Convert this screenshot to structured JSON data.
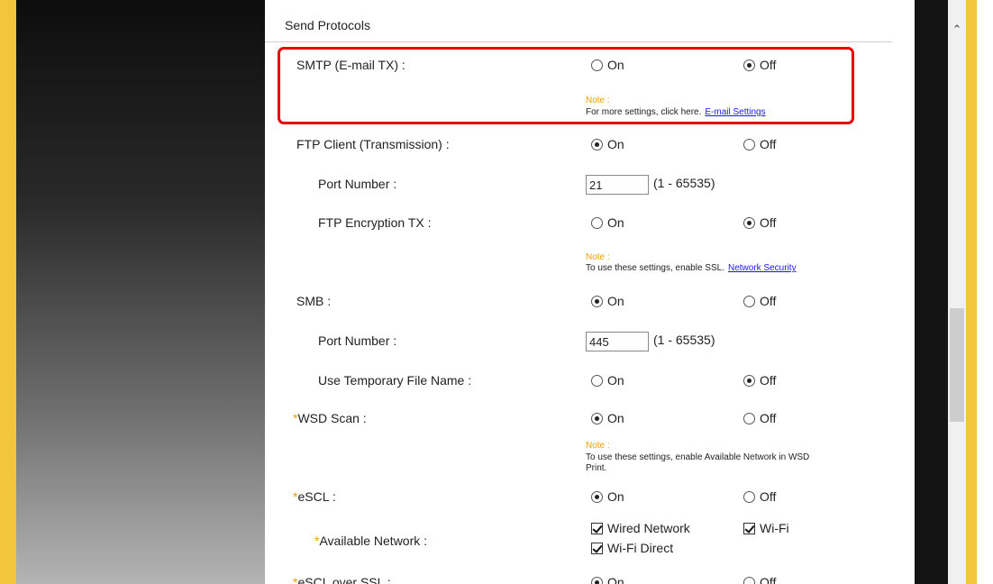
{
  "section": {
    "title": "Send Protocols"
  },
  "smtp": {
    "label": "SMTP (E-mail TX) :",
    "on": "On",
    "off": "Off",
    "selected": "off",
    "note_label": "Note :",
    "note_text": "For more settings, click here.",
    "note_link": "E-mail Settings"
  },
  "ftp_client": {
    "label": "FTP Client (Transmission) :",
    "on": "On",
    "off": "Off",
    "selected": "on"
  },
  "ftp_port": {
    "label": "Port Number :",
    "value": "21",
    "range": "(1 - 65535)"
  },
  "ftp_encryption": {
    "label": "FTP Encryption TX :",
    "on": "On",
    "off": "Off",
    "selected": "off",
    "note_label": "Note :",
    "note_text": "To use these settings, enable SSL.",
    "note_link": "Network Security"
  },
  "smb": {
    "label": "SMB :",
    "on": "On",
    "off": "Off",
    "selected": "on"
  },
  "smb_port": {
    "label": "Port Number :",
    "value": "445",
    "range": "(1 - 65535)"
  },
  "temp_file": {
    "label": "Use Temporary File Name :",
    "on": "On",
    "off": "Off",
    "selected": "off"
  },
  "wsd_scan": {
    "star": "*",
    "label": "WSD Scan :",
    "on": "On",
    "off": "Off",
    "selected": "on",
    "note_label": "Note :",
    "note_line1": "To use these settings, enable Available Network in WSD",
    "note_line2": "Print."
  },
  "escl": {
    "star": "*",
    "label": "eSCL :",
    "on": "On",
    "off": "Off",
    "selected": "on"
  },
  "available_network": {
    "star": "*",
    "label": "Available Network :",
    "wired": "Wired Network",
    "wifi": "Wi-Fi",
    "wifi_direct": "Wi-Fi Direct",
    "wired_checked": true,
    "wifi_checked": true,
    "wifi_direct_checked": true
  },
  "escl_ssl": {
    "star": "*",
    "label": "eSCL over SSL :",
    "on": "On",
    "off": "Off",
    "selected": "on"
  },
  "colors": {
    "accent_bar": "#f2c53d",
    "highlight": "#e60000",
    "note_label": "#f0a000",
    "link": "#1a1aee"
  }
}
